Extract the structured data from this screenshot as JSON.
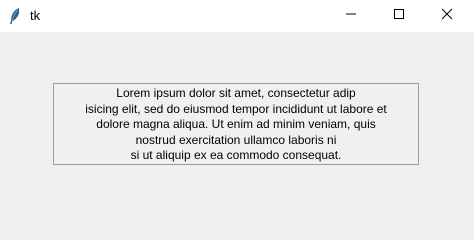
{
  "window": {
    "title": "tk",
    "icon": "feather-icon",
    "controls": {
      "minimize_icon": "minimize-icon",
      "maximize_icon": "maximize-icon",
      "close_icon": "close-icon"
    }
  },
  "message": {
    "text": "Lorem ipsum dolor sit amet, consectetur adip\nisicing elit, sed do eiusmod tempor incididunt ut labore et\ndolore magna aliqua. Ut enim ad minim veniam, quis\nnostrud exercitation ullamco laboris ni\nsi ut aliquip ex ea commodo consequat."
  }
}
